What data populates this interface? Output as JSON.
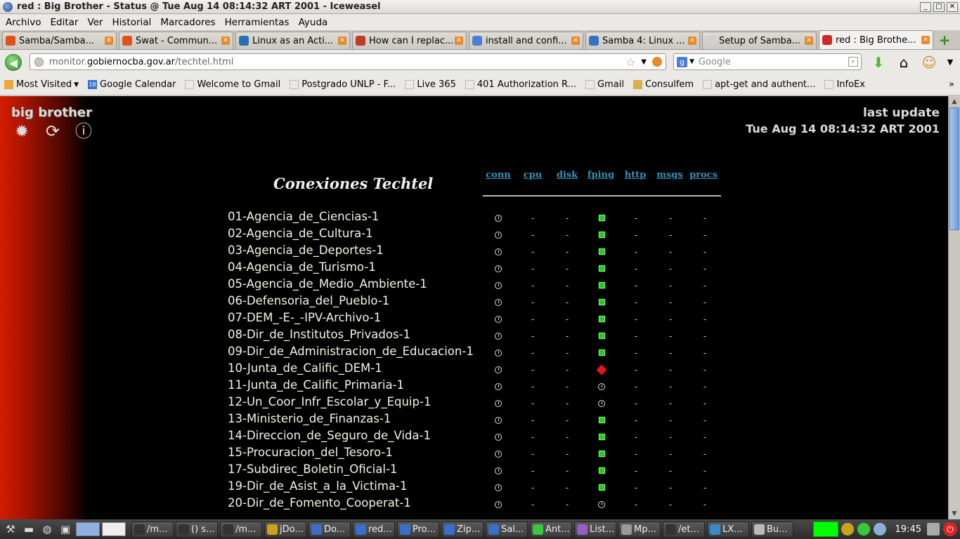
{
  "window": {
    "title": "red : Big Brother - Status @ Tue Aug 14 08:14:32 ART 2001 - Iceweasel"
  },
  "menu": [
    "Archivo",
    "Editar",
    "Ver",
    "Historial",
    "Marcadores",
    "Herramientas",
    "Ayuda"
  ],
  "tabs": [
    {
      "label": "Samba/Samba...",
      "color": "#e0501a"
    },
    {
      "label": "Swat - Commun...",
      "color": "#e0501a"
    },
    {
      "label": "Linux as an Acti...",
      "color": "#2a6fb5"
    },
    {
      "label": "How can I replac...",
      "color": "#c0392b"
    },
    {
      "label": "install and confi...",
      "color": "#4a7ed9"
    },
    {
      "label": "Samba 4: Linux ...",
      "color": "#3a6ec8"
    },
    {
      "label": "Setup of Samba...",
      "color": "#d0d0d0"
    },
    {
      "label": "red : Big Brothe...",
      "color": "#d02828"
    }
  ],
  "nav": {
    "url_prefix": "monitor.",
    "url_domain": "gobiernocba.gov.ar",
    "url_path": "/techtel.html",
    "search_placeholder": "Google"
  },
  "bookmarks": [
    {
      "label": "Most Visited",
      "type": "folder"
    },
    {
      "label": "Google Calendar",
      "type": "cal"
    },
    {
      "label": "Welcome to Gmail",
      "type": "page"
    },
    {
      "label": "Postgrado UNLP - F...",
      "type": "page"
    },
    {
      "label": "Live 365",
      "type": "page"
    },
    {
      "label": "401 Authorization R...",
      "type": "page"
    },
    {
      "label": "Gmail",
      "type": "page"
    },
    {
      "label": "Consulfem",
      "type": "cons"
    },
    {
      "label": "apt-get and authent...",
      "type": "page"
    },
    {
      "label": "InfoEx",
      "type": "page"
    }
  ],
  "bb": {
    "logo": "big brother",
    "last_update_label": "last update",
    "last_update_time": "Tue Aug 14 08:14:32 ART 2001",
    "heading": "Conexiones Techtel",
    "columns": [
      "conn",
      "cpu",
      "disk",
      "fping",
      "http",
      "msgs",
      "procs"
    ],
    "hosts": [
      {
        "name": "01-Agencia_de_Ciencias-1",
        "fping": "green"
      },
      {
        "name": "02-Agencia_de_Cultura-1",
        "fping": "green"
      },
      {
        "name": "03-Agencia_de_Deportes-1",
        "fping": "green"
      },
      {
        "name": "04-Agencia_de_Turismo-1",
        "fping": "green"
      },
      {
        "name": "05-Agencia_de_Medio_Ambiente-1",
        "fping": "green"
      },
      {
        "name": "06-Defensoria_del_Pueblo-1",
        "fping": "green"
      },
      {
        "name": "07-DEM_-E-_-IPV-Archivo-1",
        "fping": "green"
      },
      {
        "name": "08-Dir_de_Institutos_Privados-1",
        "fping": "green"
      },
      {
        "name": "09-Dir_de_Administracion_de_Educacion-1",
        "fping": "green"
      },
      {
        "name": "10-Junta_de_Calific_DEM-1",
        "fping": "red"
      },
      {
        "name": "11-Junta_de_Calific_Primaria-1",
        "fping": "clock"
      },
      {
        "name": "12-Un_Coor_Infr_Escolar_y_Equip-1",
        "fping": "clock"
      },
      {
        "name": "13-Ministerio_de_Finanzas-1",
        "fping": "green"
      },
      {
        "name": "14-Direccion_de_Seguro_de_Vida-1",
        "fping": "green"
      },
      {
        "name": "15-Procuracion_del_Tesoro-1",
        "fping": "green"
      },
      {
        "name": "17-Subdirec_Boletin_Oficial-1",
        "fping": "green"
      },
      {
        "name": "19-Dir_de_Asist_a_la_Victima-1",
        "fping": "green"
      },
      {
        "name": "20-Dir_de_Fomento_Cooperat-1",
        "fping": "clock"
      }
    ]
  },
  "taskbar": {
    "tasks": [
      {
        "label": "/m...",
        "color": "#333"
      },
      {
        "label": "() s...",
        "color": "#333"
      },
      {
        "label": "/m...",
        "color": "#333"
      },
      {
        "label": "jDo...",
        "color": "#c9a41a"
      },
      {
        "label": "Do...",
        "color": "#3a6ec8"
      },
      {
        "label": "red...",
        "color": "#3a6ec8"
      },
      {
        "label": "Pro...",
        "color": "#3a6ec8"
      },
      {
        "label": "Zip...",
        "color": "#3a6ec8"
      },
      {
        "label": "Sal...",
        "color": "#3a6ec8"
      },
      {
        "label": "Ant...",
        "color": "#3ac83a"
      },
      {
        "label": "List...",
        "color": "#9a5ac8"
      },
      {
        "label": "Mp...",
        "color": "#999"
      },
      {
        "label": "/et...",
        "color": "#333"
      },
      {
        "label": "LX...",
        "color": "#3a8ac8"
      },
      {
        "label": "Bu...",
        "color": "#bbb"
      }
    ],
    "time": "19:45"
  }
}
